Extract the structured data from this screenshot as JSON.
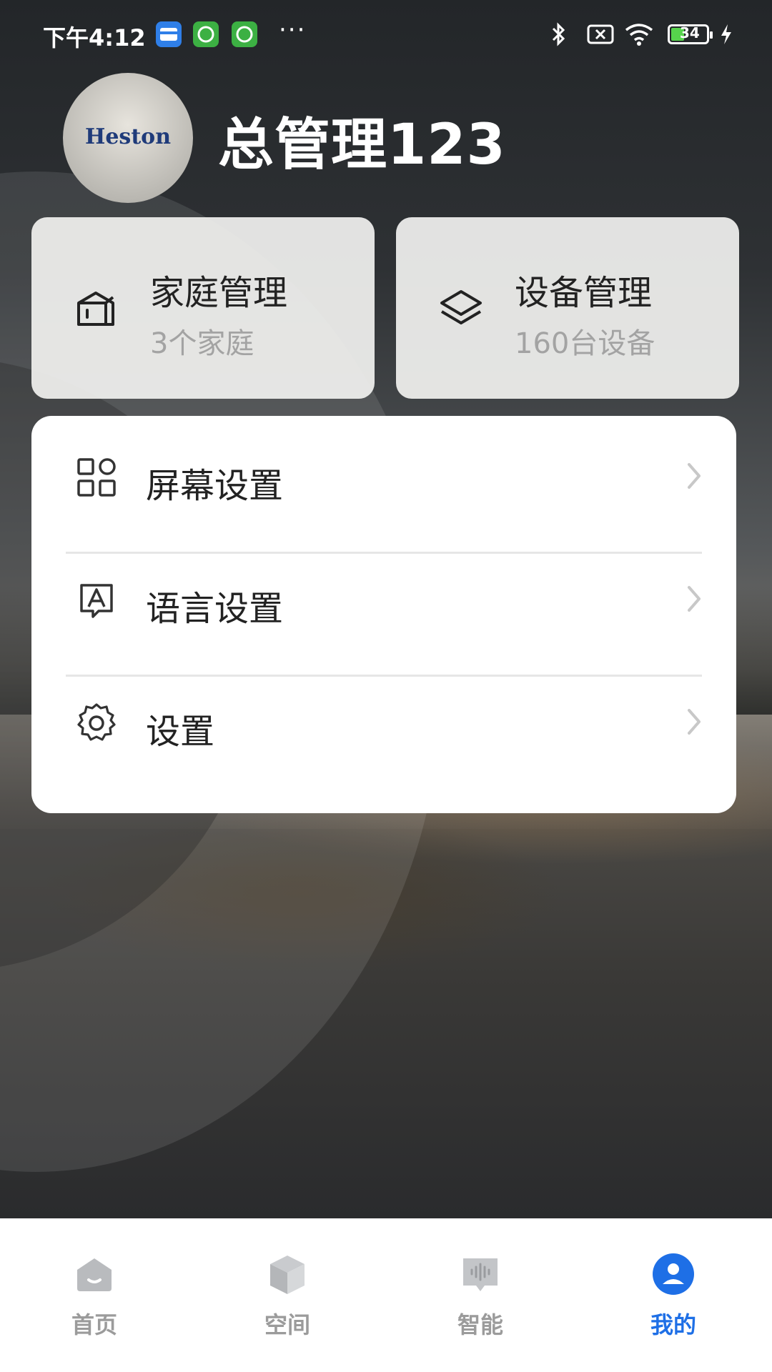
{
  "status_bar": {
    "time": "下午4:12",
    "battery": "34"
  },
  "profile": {
    "avatar_logo_text": "Heston",
    "username": "总管理123"
  },
  "tiles": [
    {
      "title": "家庭管理",
      "subtitle": "3个家庭",
      "icon": "house-box-icon"
    },
    {
      "title": "设备管理",
      "subtitle": "160台设备",
      "icon": "layers-icon"
    }
  ],
  "menu": [
    {
      "label": "屏幕设置",
      "icon": "grid-icon"
    },
    {
      "label": "语言设置",
      "icon": "language-icon"
    },
    {
      "label": "设置",
      "icon": "gear-icon"
    }
  ],
  "bottom_nav": [
    {
      "label": "首页",
      "icon": "home-icon",
      "active": false
    },
    {
      "label": "空间",
      "icon": "cube-icon",
      "active": false
    },
    {
      "label": "智能",
      "icon": "voice-chat-icon",
      "active": false
    },
    {
      "label": "我的",
      "icon": "user-icon",
      "active": true
    }
  ],
  "colors": {
    "accent": "#1e6fe6",
    "inactive_nav": "#9b9b9b",
    "tile_bg": "#f2f2f0",
    "battery_green": "#56d34c"
  }
}
